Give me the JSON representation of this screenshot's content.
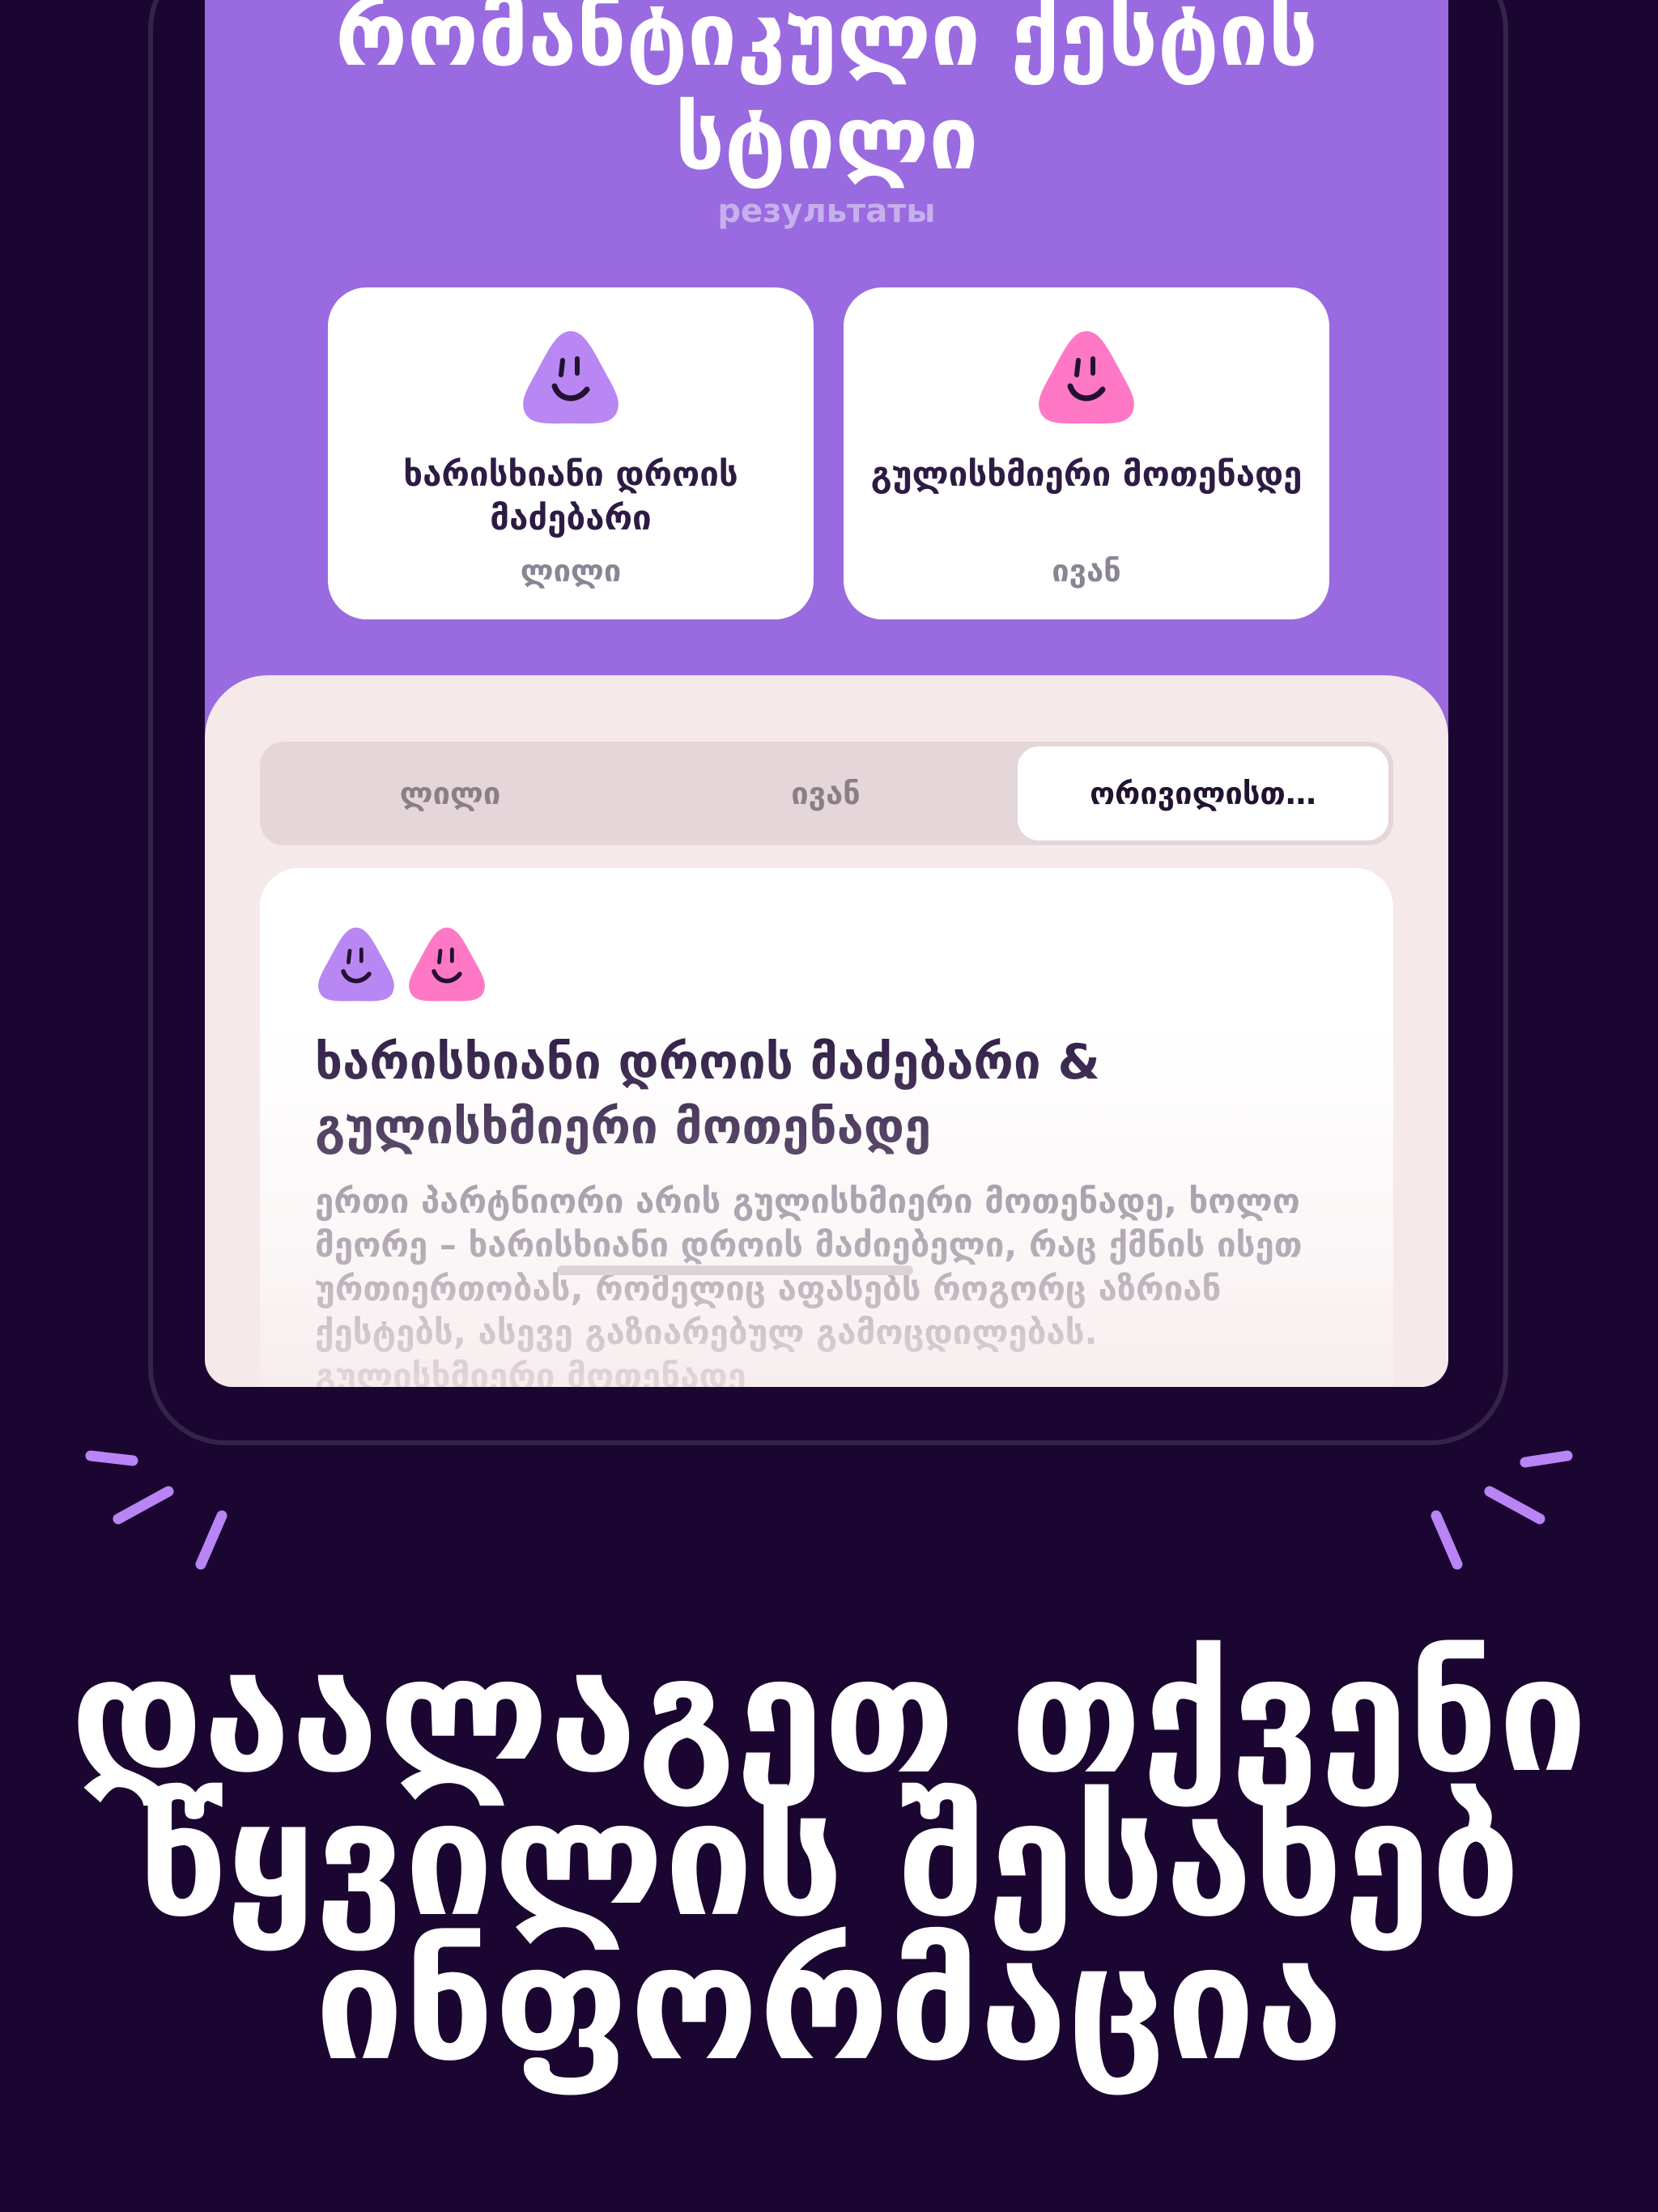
{
  "hero": {
    "title": "რომანტიკული ქესტის სტილი",
    "subtitle": "результаты"
  },
  "result_cards": [
    {
      "title": "ხარისხიანი დროის მაძებარი",
      "name": "ლილი",
      "color": "#b887f3"
    },
    {
      "title": "გულისხმიერი მოთენადე",
      "name": "ივან",
      "color": "#ff78c6"
    }
  ],
  "tabs": [
    {
      "label": "ლილი",
      "active": false
    },
    {
      "label": "ივან",
      "active": false
    },
    {
      "label": "ორივილისთ…",
      "active": true
    }
  ],
  "detail": {
    "title": "ხარისხიანი დროის მაძებარი & გულისხმიერი მოთენადე",
    "text": "ერთი პარტნიორი არის გულისხმიერი მოთენადე, ხოლო მეორე – ხარისხიანი დროის მაძიებელი, რაც ქმნის ისეთ ურთიერთობას, რომელიც აფასებს როგორც აზრიან ქესტებს, ასევე გაზიარებულ გამოცდილებას. გულისხმიერი მოთენადე"
  },
  "headline": "დაალაგეთ თქვენი წყვილის შესახებ ინფორმაცია",
  "colors": {
    "background": "#1a0630",
    "screen": "#9a6ae0",
    "panel": "#f5e9ea",
    "accent_spark": "#b984f5"
  },
  "icons": [
    "purple-blob-face-icon",
    "pink-blob-face-icon"
  ]
}
